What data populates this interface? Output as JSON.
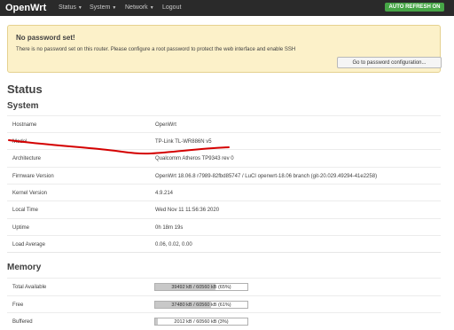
{
  "header": {
    "brand": "OpenWrt",
    "nav": [
      {
        "label": "Status",
        "has_menu": true
      },
      {
        "label": "System",
        "has_menu": true
      },
      {
        "label": "Network",
        "has_menu": true
      },
      {
        "label": "Logout",
        "has_menu": false
      }
    ],
    "auto_refresh": "AUTO REFRESH ON"
  },
  "alert": {
    "title": "No password set!",
    "text": "There is no password set on this router. Please configure a root password to protect the web interface and enable SSH",
    "button": "Go to password configuration..."
  },
  "page_title": "Status",
  "system": {
    "title": "System",
    "rows": [
      {
        "label": "Hostname",
        "value": "OpenWrt"
      },
      {
        "label": "Model",
        "value": "TP-Link TL-WR886N v5"
      },
      {
        "label": "Architecture",
        "value": "Qualcomm Atheros TP9343 rev 0"
      },
      {
        "label": "Firmware Version",
        "value": "OpenWrt 18.06.8 r7989-82fbd85747 / LuCI openwrt-18.06 branch (git-20.029.49294-41e2258)"
      },
      {
        "label": "Kernel Version",
        "value": "4.9.214"
      },
      {
        "label": "Local Time",
        "value": "Wed Nov 11 11:56:36 2020"
      },
      {
        "label": "Uptime",
        "value": "0h 18m 19s"
      },
      {
        "label": "Load Average",
        "value": "0.06, 0.02, 0.00"
      }
    ]
  },
  "memory": {
    "title": "Memory",
    "rows": [
      {
        "label": "Total Available",
        "text": "39492 kB / 60560 kB (65%)",
        "fraction": 0.65
      },
      {
        "label": "Free",
        "text": "37480 kB / 60560 kB (61%)",
        "fraction": 0.61
      },
      {
        "label": "Buffered",
        "text": "2012 kB / 60560 kB (3%)",
        "fraction": 0.03
      }
    ]
  },
  "colors": {
    "topbar": "#2a2a2a",
    "auto_refresh": "#46a546",
    "alert_bg": "#fcf1c9",
    "annotation": "#d40000"
  }
}
